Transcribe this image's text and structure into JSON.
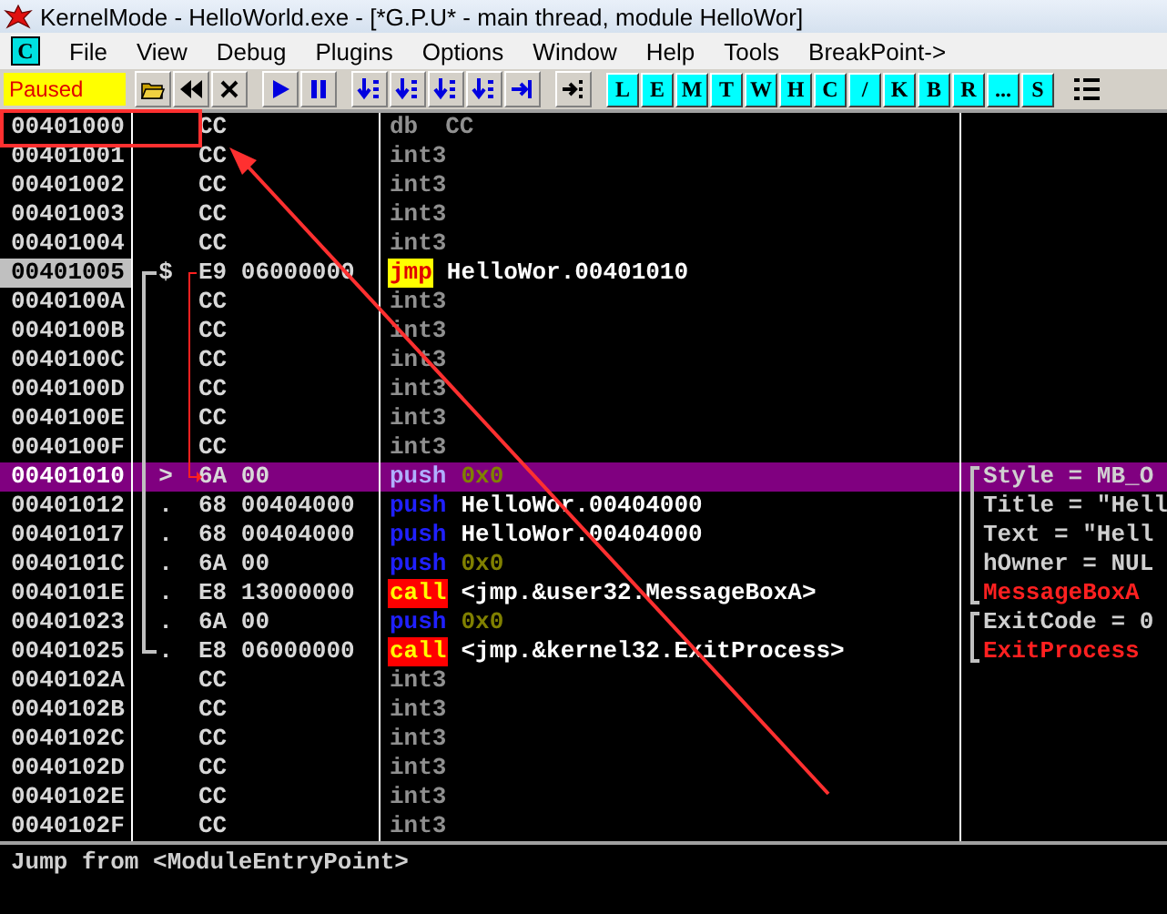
{
  "window": {
    "title": "KernelMode - HelloWorld.exe - [*G.P.U* - main thread, module HelloWor]"
  },
  "menu": {
    "logo": "C",
    "items": [
      "File",
      "View",
      "Debug",
      "Plugins",
      "Options",
      "Window",
      "Help",
      "Tools",
      "BreakPoint->"
    ]
  },
  "toolbar": {
    "status": "Paused",
    "letters": [
      "L",
      "E",
      "M",
      "T",
      "W",
      "H",
      "C",
      "/",
      "K",
      "B",
      "R",
      "...",
      "S"
    ]
  },
  "rows": [
    {
      "address": "00401000",
      "label": false,
      "hex": "CC",
      "mnemonic": {
        "text": "db",
        "kind": "data"
      },
      "operand": {
        "text": "CC",
        "kind": "data"
      },
      "selected": false
    },
    {
      "address": "00401001",
      "label": false,
      "hex": "CC",
      "mnemonic": {
        "text": "int3",
        "kind": "data"
      },
      "selected": false
    },
    {
      "address": "00401002",
      "label": false,
      "hex": "CC",
      "mnemonic": {
        "text": "int3",
        "kind": "data"
      },
      "selected": false
    },
    {
      "address": "00401003",
      "label": false,
      "hex": "CC",
      "mnemonic": {
        "text": "int3",
        "kind": "data"
      },
      "selected": false
    },
    {
      "address": "00401004",
      "label": false,
      "hex": "CC",
      "mnemonic": {
        "text": "int3",
        "kind": "data"
      },
      "selected": false
    },
    {
      "address": "00401005",
      "label": true,
      "marker": "$",
      "bracket_start": true,
      "jump_source": true,
      "hex": "E9 06000000",
      "mnemonic": {
        "text": "jmp",
        "kind": "jump"
      },
      "operand": {
        "text": "HelloWor.00401010",
        "kind": "plain"
      },
      "selected": false
    },
    {
      "address": "0040100A",
      "label": false,
      "hex": "CC",
      "mnemonic": {
        "text": "int3",
        "kind": "data"
      },
      "selected": false
    },
    {
      "address": "0040100B",
      "label": false,
      "hex": "CC",
      "mnemonic": {
        "text": "int3",
        "kind": "data"
      },
      "selected": false
    },
    {
      "address": "0040100C",
      "label": false,
      "hex": "CC",
      "mnemonic": {
        "text": "int3",
        "kind": "data"
      },
      "selected": false
    },
    {
      "address": "0040100D",
      "label": false,
      "hex": "CC",
      "mnemonic": {
        "text": "int3",
        "kind": "data"
      },
      "selected": false
    },
    {
      "address": "0040100E",
      "label": false,
      "hex": "CC",
      "mnemonic": {
        "text": "int3",
        "kind": "data"
      },
      "selected": false
    },
    {
      "address": "0040100F",
      "label": false,
      "hex": "CC",
      "mnemonic": {
        "text": "int3",
        "kind": "data"
      },
      "selected": false
    },
    {
      "address": "00401010",
      "label": false,
      "marker": ">",
      "jump_target": true,
      "hex": "6A 00",
      "mnemonic": {
        "text": "push",
        "kind": "push"
      },
      "operand": {
        "text": "0x0",
        "kind": "const"
      },
      "comment": {
        "text": "Style = MB_O",
        "kind": "plain"
      },
      "group_start": true,
      "selected": true
    },
    {
      "address": "00401012",
      "label": false,
      "marker": ".",
      "hex": "68 00404000",
      "mnemonic": {
        "text": "push",
        "kind": "push"
      },
      "operand": {
        "text": "HelloWor.00404000",
        "kind": "plain"
      },
      "comment": {
        "text": "Title = \"Hell",
        "kind": "plain"
      },
      "selected": false
    },
    {
      "address": "00401017",
      "label": false,
      "marker": ".",
      "hex": "68 00404000",
      "mnemonic": {
        "text": "push",
        "kind": "push"
      },
      "operand": {
        "text": "HelloWor.00404000",
        "kind": "plain"
      },
      "comment": {
        "text": "Text = \"Hell",
        "kind": "plain"
      },
      "selected": false
    },
    {
      "address": "0040101C",
      "label": false,
      "marker": ".",
      "hex": "6A 00",
      "mnemonic": {
        "text": "push",
        "kind": "push"
      },
      "operand": {
        "text": "0x0",
        "kind": "const"
      },
      "comment": {
        "text": "hOwner = NUL",
        "kind": "plain"
      },
      "selected": false
    },
    {
      "address": "0040101E",
      "label": false,
      "marker": ".",
      "hex": "E8 13000000",
      "mnemonic": {
        "text": "call",
        "kind": "call"
      },
      "operand": {
        "text": "<jmp.&user32.MessageBoxA>",
        "kind": "plain"
      },
      "comment": {
        "text": "MessageBoxA",
        "kind": "api"
      },
      "group_end": true,
      "selected": false
    },
    {
      "address": "00401023",
      "label": false,
      "marker": ".",
      "hex": "6A 00",
      "mnemonic": {
        "text": "push",
        "kind": "push"
      },
      "operand": {
        "text": "0x0",
        "kind": "const"
      },
      "comment": {
        "text": "ExitCode = 0",
        "kind": "plain"
      },
      "group_start": true,
      "selected": false
    },
    {
      "address": "00401025",
      "label": false,
      "marker": ".",
      "bracket_end": true,
      "hex": "E8 06000000",
      "mnemonic": {
        "text": "call",
        "kind": "call"
      },
      "operand": {
        "text": "<jmp.&kernel32.ExitProcess>",
        "kind": "plain"
      },
      "comment": {
        "text": "ExitProcess",
        "kind": "api"
      },
      "group_end": true,
      "selected": false
    },
    {
      "address": "0040102A",
      "label": false,
      "hex": "CC",
      "mnemonic": {
        "text": "int3",
        "kind": "data"
      },
      "selected": false
    },
    {
      "address": "0040102B",
      "label": false,
      "hex": "CC",
      "mnemonic": {
        "text": "int3",
        "kind": "data"
      },
      "selected": false
    },
    {
      "address": "0040102C",
      "label": false,
      "hex": "CC",
      "mnemonic": {
        "text": "int3",
        "kind": "data"
      },
      "selected": false
    },
    {
      "address": "0040102D",
      "label": false,
      "hex": "CC",
      "mnemonic": {
        "text": "int3",
        "kind": "data"
      },
      "selected": false
    },
    {
      "address": "0040102E",
      "label": false,
      "hex": "CC",
      "mnemonic": {
        "text": "int3",
        "kind": "data"
      },
      "selected": false
    },
    {
      "address": "0040102F",
      "label": false,
      "hex": "CC",
      "mnemonic": {
        "text": "int3",
        "kind": "data"
      },
      "selected": false
    }
  ],
  "info": "Jump from <ModuleEntryPoint>"
}
